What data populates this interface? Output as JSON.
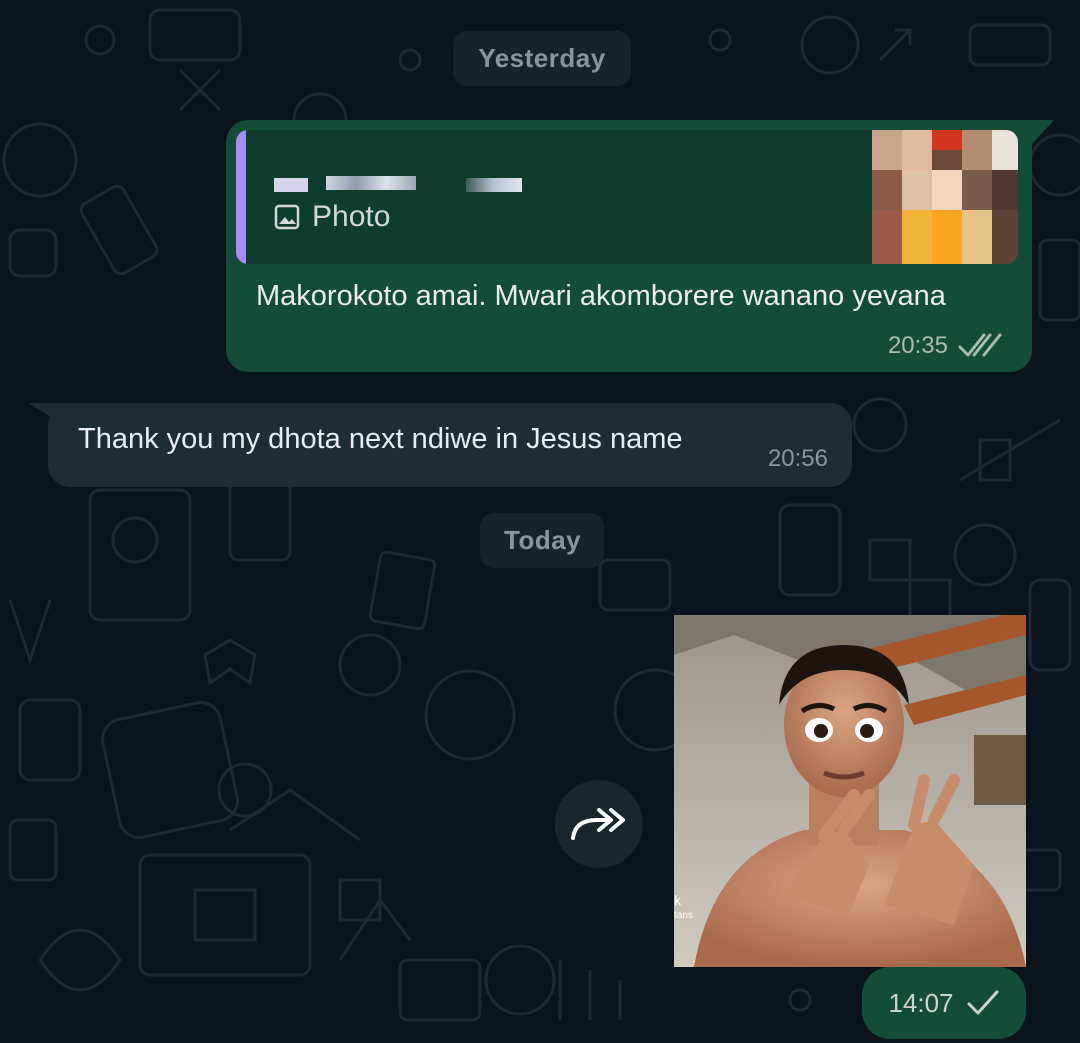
{
  "dates": {
    "yesterday": "Yesterday",
    "today": "Today"
  },
  "messages": [
    {
      "direction": "outgoing",
      "quote": {
        "type_icon": "image-icon",
        "type_label": "Photo",
        "sender_obscured": true
      },
      "text": "Makorokoto amai. Mwari akomborere wanano yevana",
      "time": "20:35",
      "status": "read"
    },
    {
      "direction": "incoming",
      "text": "Thank you my dhota next ndiwe in Jesus name",
      "time": "20:56"
    },
    {
      "direction": "outgoing",
      "media": "photo",
      "forward_icon": "forward-icon",
      "media_overlay_text": "k tans",
      "time": "14:07",
      "status": "sent"
    }
  ],
  "colors": {
    "background": "#0b141a",
    "outgoing_bubble": "#144d37",
    "incoming_bubble": "#202c33",
    "quote_accent": "#a78bfa",
    "date_pill": "#182229",
    "read_ticks": "#a8bcb1"
  }
}
